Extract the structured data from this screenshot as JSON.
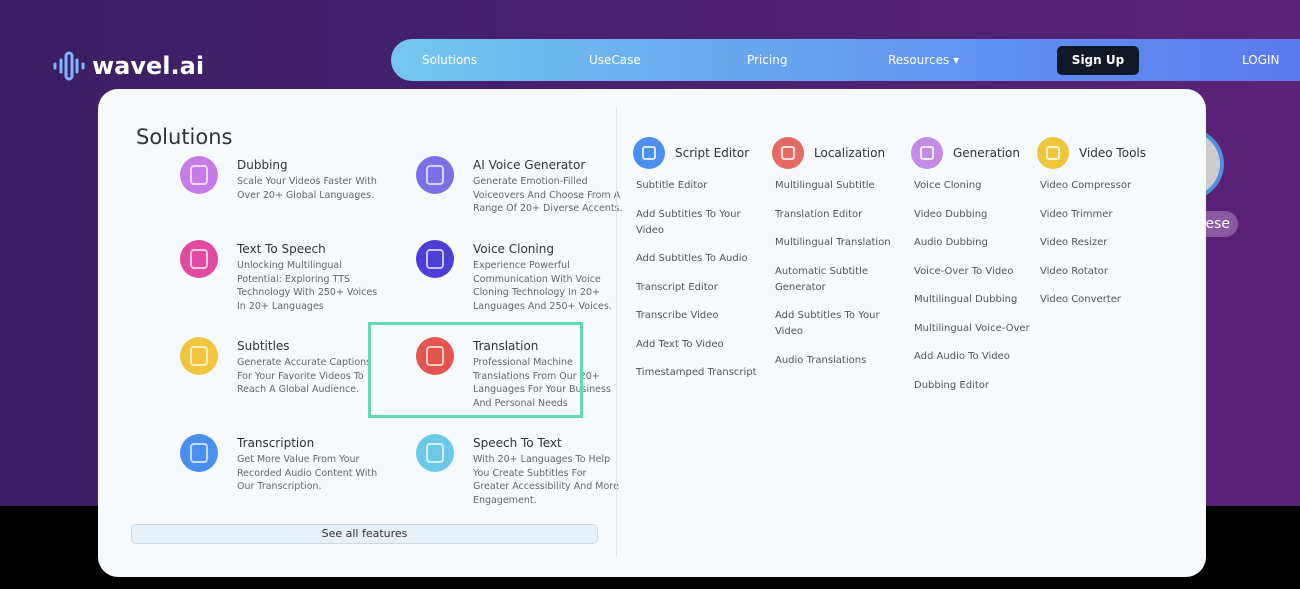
{
  "logo": {
    "text": "wavel.ai"
  },
  "nav": {
    "items": [
      "Solutions",
      "UseCase",
      "Pricing",
      "Resources ▾"
    ],
    "signup": "Sign Up",
    "login": "LOGIN"
  },
  "lang_badge": "nese",
  "solutions": {
    "title": "Solutions",
    "see_all": "See all features",
    "items": [
      {
        "title": "Dubbing",
        "desc": "Scale Your Videos Faster With Over 20+ Global Languages.",
        "color": "#c77be6"
      },
      {
        "title": "AI Voice Generator",
        "desc": "Generate Emotion-Filled Voiceovers And Choose From A Range Of 20+ Diverse Accents.",
        "color": "#7b6fe6"
      },
      {
        "title": "Text To Speech",
        "desc": "Unlocking Multilingual Potential: Exploring TTS Technology With 250+ Voices In 20+ Languages",
        "color": "#e04aa0"
      },
      {
        "title": "Voice Cloning",
        "desc": "Experience Powerful Communication With Voice Cloning Technology In 20+ Languages And 250+ Voices.",
        "color": "#4b3fd6"
      },
      {
        "title": "Subtitles",
        "desc": "Generate Accurate Captions For Your Favorite Videos To Reach A Global Audience.",
        "color": "#f0c63e"
      },
      {
        "title": "Translation",
        "desc": "Professional Machine Translations From Our 20+ Languages For Your Business And Personal Needs",
        "color": "#e2564e"
      },
      {
        "title": "Transcription",
        "desc": "Get More Value From Your Recorded Audio Content With Our Transcription.",
        "color": "#4a8ef0"
      },
      {
        "title": "Speech To Text",
        "desc": "With 20+ Languages To Help You Create Subtitles For Greater Accessibility And More Engagement.",
        "color": "#6cc9e6"
      }
    ]
  },
  "columns": [
    {
      "title": "Script Editor",
      "color": "#4a8ef0",
      "items": [
        "Subtitle Editor",
        "Add Subtitles To Your Video",
        "Add Subtitles To Audio",
        "Transcript Editor",
        "Transcribe Video",
        "Add Text To Video",
        "Timestamped Transcript"
      ]
    },
    {
      "title": "Localization",
      "color": "#e56b62",
      "items": [
        "Multilingual Subtitle",
        "Translation Editor",
        "Multilingual Translation",
        "Automatic Subtitle Generator",
        "Add Subtitles To Your Video",
        "Audio Translations"
      ]
    },
    {
      "title": "Generation",
      "color": "#c48be6",
      "items": [
        "Voice Cloning",
        "Video Dubbing",
        "Audio Dubbing",
        "Voice-Over To Video",
        "Multilingual Dubbing",
        "Multilingual Voice-Over",
        "Add Audio To Video",
        "Dubbing Editor"
      ]
    },
    {
      "title": "Video Tools",
      "color": "#f0c63e",
      "items": [
        "Video Compressor",
        "Video Trimmer",
        "Video Resizer",
        "Video Rotator",
        "Video Converter"
      ]
    }
  ]
}
